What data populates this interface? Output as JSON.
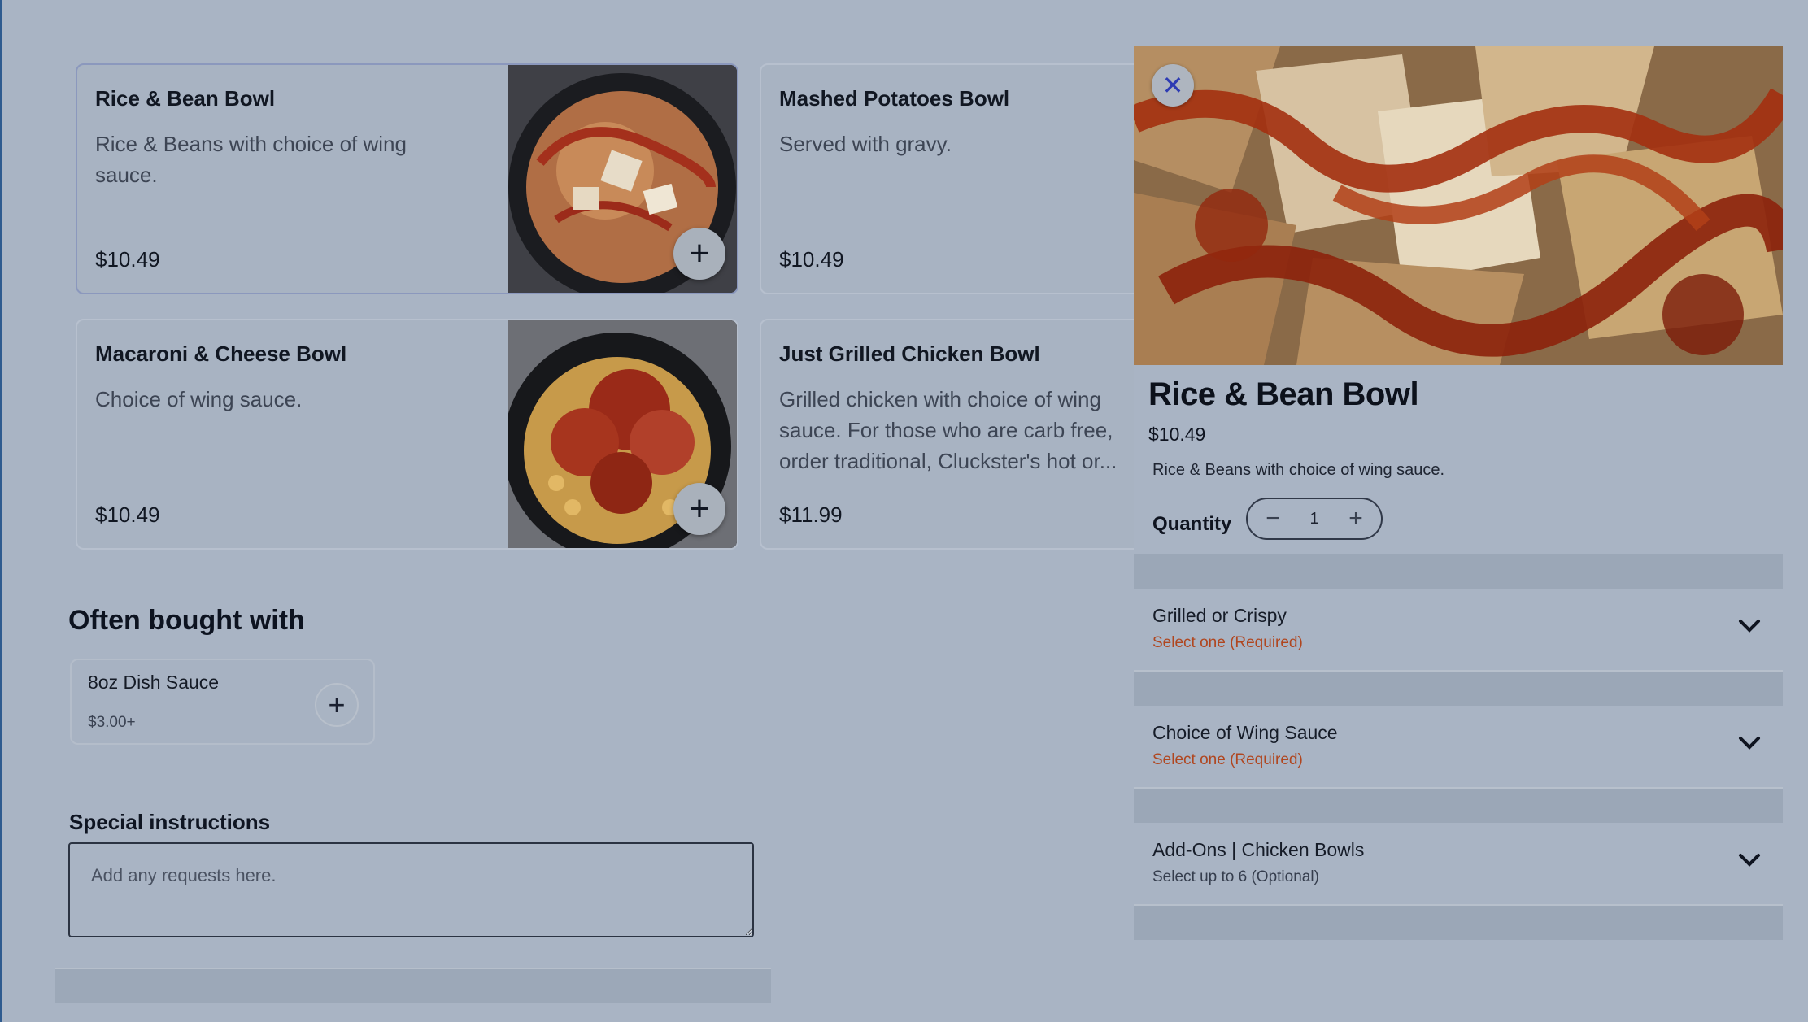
{
  "menu_cards": [
    {
      "title": "Rice & Bean Bowl",
      "description": "Rice & Beans with choice of wing sauce.",
      "price": "$10.49"
    },
    {
      "title": "Mashed Potatoes Bowl",
      "description": "Served with gravy.",
      "price": "$10.49"
    },
    {
      "title": "Macaroni & Cheese Bowl",
      "description": "Choice of wing sauce.",
      "price": "$10.49"
    },
    {
      "title": "Just Grilled Chicken Bowl",
      "description": "Grilled chicken with choice of wing sauce. For those who are carb free, order traditional, Cluckster's hot or...",
      "price": "$11.99"
    }
  ],
  "often_bought": {
    "heading": "Often bought with",
    "items": [
      {
        "name": "8oz Dish Sauce",
        "price": "$3.00+"
      }
    ]
  },
  "special_instructions": {
    "label": "Special instructions",
    "placeholder": "Add any requests here."
  },
  "detail_panel": {
    "title": "Rice & Bean Bowl",
    "price": "$10.49",
    "description": "Rice & Beans with choice of wing sauce.",
    "quantity_label": "Quantity",
    "quantity_value": "1",
    "options": [
      {
        "title": "Grilled or Crispy",
        "subtitle": "Select one (Required)",
        "required": true
      },
      {
        "title": "Choice of Wing Sauce",
        "subtitle": "Select one (Required)",
        "required": true
      },
      {
        "title": "Add-Ons | Chicken Bowls",
        "subtitle": "Select up to 6 (Optional)",
        "required": false
      }
    ]
  },
  "colors": {
    "overlay_background": "#a9b4c4",
    "required_text": "#b0461f",
    "close_icon": "#2d3bb3"
  },
  "icons": {
    "add": "plus-icon",
    "close": "close-icon",
    "decrease": "minus-icon",
    "increase": "plus-icon",
    "expand": "chevron-down-icon"
  }
}
